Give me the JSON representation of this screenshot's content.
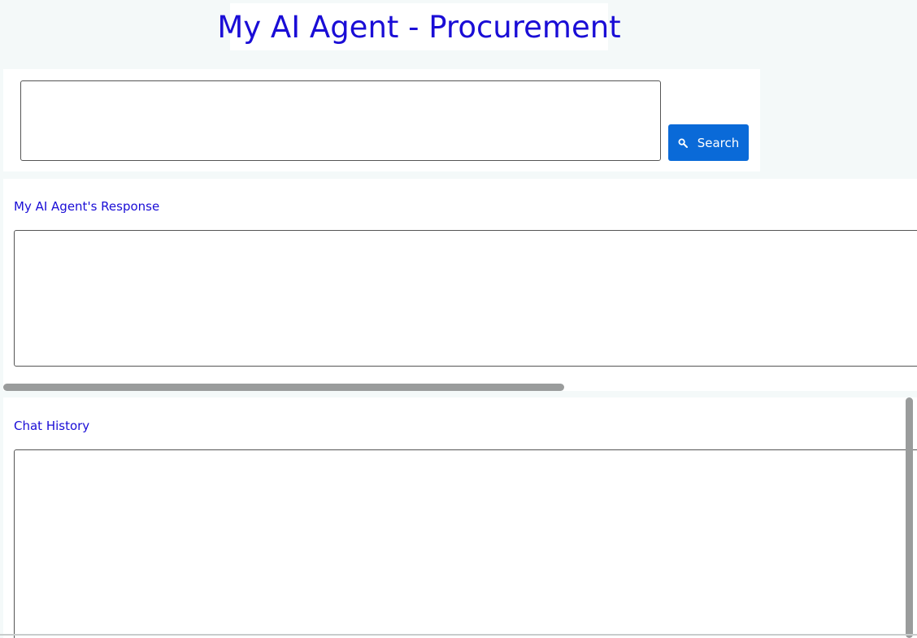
{
  "header": {
    "title": "My AI Agent - Procurement"
  },
  "query": {
    "value": "",
    "placeholder": ""
  },
  "search_button": {
    "label": "Search",
    "icon": "search-icon"
  },
  "response": {
    "heading": "My AI Agent's Response",
    "value": ""
  },
  "history": {
    "heading": "Chat History",
    "value": ""
  },
  "colors": {
    "accent_text": "#1a0dd6",
    "button_bg": "#0a6ad8",
    "page_bg": "#f4f9f9"
  }
}
